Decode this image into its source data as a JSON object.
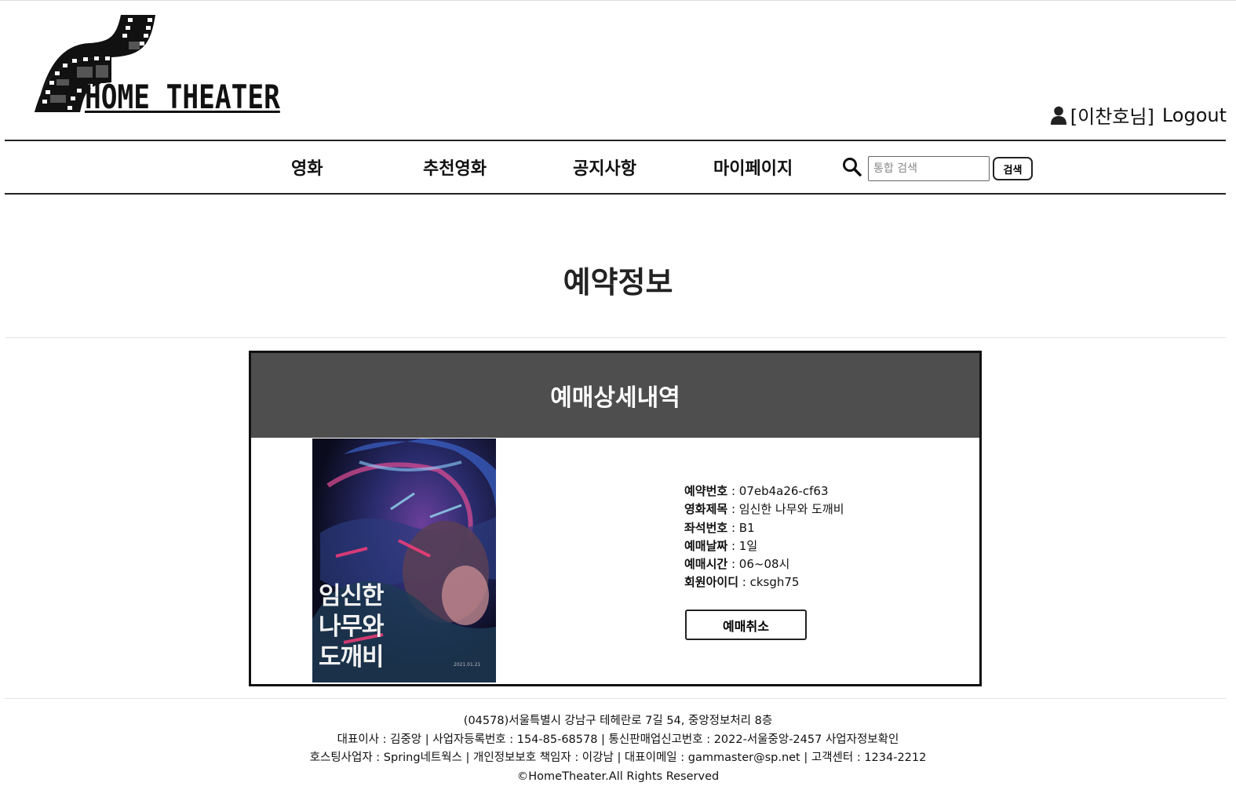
{
  "header": {
    "logo_text": "HOME THEATER",
    "user_name": "[이찬호님]",
    "logout_label": "Logout"
  },
  "nav": {
    "items": [
      {
        "label": "영화"
      },
      {
        "label": "추천영화"
      },
      {
        "label": "공지사항"
      },
      {
        "label": "마이페이지"
      }
    ],
    "search_placeholder": "통합 검색",
    "search_button": "검색"
  },
  "main": {
    "title": "예약정보",
    "card_title": "예매상세내역",
    "poster": {
      "title_lines": [
        "임신한",
        "나무와",
        "도깨비"
      ]
    },
    "details": [
      {
        "label": "예약번호",
        "value": "07eb4a26-cf63"
      },
      {
        "label": "영화제목",
        "value": "임신한 나무와 도깨비"
      },
      {
        "label": "좌석번호",
        "value": "B1"
      },
      {
        "label": "예매날짜",
        "value": "1일"
      },
      {
        "label": "예매시간",
        "value": "06~08시"
      },
      {
        "label": "회원아이디",
        "value": "cksgh75"
      }
    ],
    "cancel_label": "예매취소"
  },
  "footer": {
    "lines": [
      "(04578)서울특별시 강남구 테헤란로 7길 54, 중앙정보처리 8층",
      "대표이사 : 김중앙 | 사업자등록번호 : 154-85-68578 | 통신판매업신고번호 : 2022-서울중앙-2457 사업자정보확인",
      "호스팅사업자 : Spring네트웍스 | 개인정보보호 책임자 : 이강남 | 대표이메일 : gammaster@sp.net | 고객센터 : 1234-2212",
      "©HomeTheater.All Rights Reserved"
    ]
  }
}
